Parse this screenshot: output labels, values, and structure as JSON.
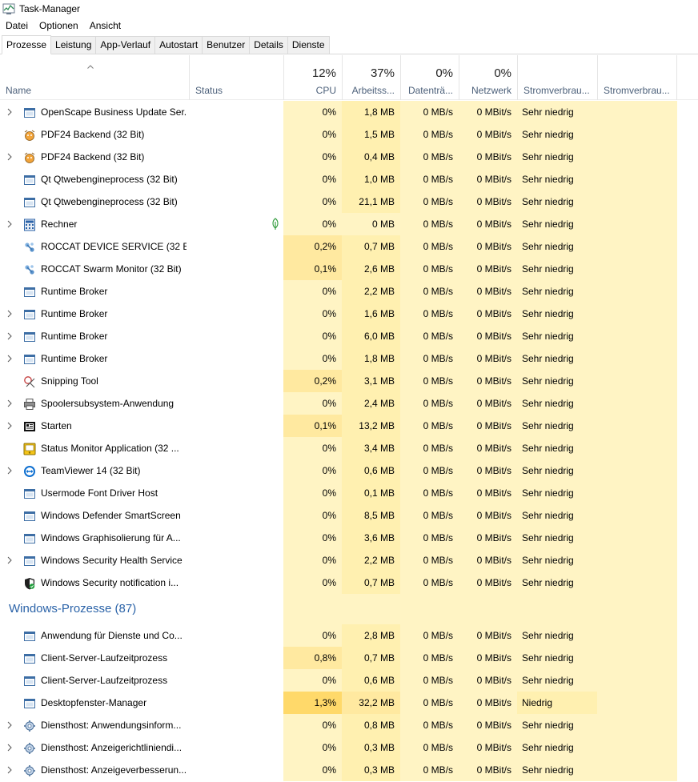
{
  "window": {
    "title": "Task-Manager"
  },
  "menu": [
    "Datei",
    "Optionen",
    "Ansicht"
  ],
  "tabs": [
    "Prozesse",
    "Leistung",
    "App-Verlauf",
    "Autostart",
    "Benutzer",
    "Details",
    "Dienste"
  ],
  "active_tab": "Prozesse",
  "header": {
    "name": "Name",
    "status": "Status",
    "cpu": {
      "pct": "12%",
      "label": "CPU"
    },
    "mem": {
      "pct": "37%",
      "label": "Arbeitss..."
    },
    "disk": {
      "pct": "0%",
      "label": "Datenträ..."
    },
    "net": {
      "pct": "0%",
      "label": "Netzwerk"
    },
    "power": {
      "label": "Stromverbrau..."
    },
    "power_trend": {
      "label": "Stromverbrau..."
    }
  },
  "colors": {
    "accent": "#2b63a8",
    "heat_low": "#fff4c4",
    "heat_mid": "#fff0b0",
    "heat_high": "#ffe9a0",
    "heat_max": "#ffd96a"
  },
  "apps": [
    {
      "name": "OpenScape Business Update Ser...",
      "icon": "window-app-icon",
      "expand": true,
      "cpu": "0%",
      "mem": "1,8 MB",
      "disk": "0 MB/s",
      "net": "0 MBit/s",
      "power": "Sehr niedrig"
    },
    {
      "name": "PDF24 Backend (32 Bit)",
      "icon": "pdf24-icon",
      "expand": false,
      "cpu": "0%",
      "mem": "1,5 MB",
      "disk": "0 MB/s",
      "net": "0 MBit/s",
      "power": "Sehr niedrig"
    },
    {
      "name": "PDF24 Backend (32 Bit)",
      "icon": "pdf24-icon",
      "expand": true,
      "cpu": "0%",
      "mem": "0,4 MB",
      "disk": "0 MB/s",
      "net": "0 MBit/s",
      "power": "Sehr niedrig"
    },
    {
      "name": "Qt Qtwebengineprocess (32 Bit)",
      "icon": "window-app-icon",
      "expand": false,
      "cpu": "0%",
      "mem": "1,0 MB",
      "disk": "0 MB/s",
      "net": "0 MBit/s",
      "power": "Sehr niedrig"
    },
    {
      "name": "Qt Qtwebengineprocess (32 Bit)",
      "icon": "window-app-icon",
      "expand": false,
      "cpu": "0%",
      "mem": "21,1 MB",
      "disk": "0 MB/s",
      "net": "0 MBit/s",
      "power": "Sehr niedrig"
    },
    {
      "name": "Rechner",
      "icon": "calculator-icon",
      "expand": true,
      "status_leaf": true,
      "cpu": "0%",
      "mem": "0 MB",
      "disk": "0 MB/s",
      "net": "0 MBit/s",
      "power": "Sehr niedrig"
    },
    {
      "name": "ROCCAT DEVICE SERVICE (32 Bit)",
      "icon": "roccat-icon",
      "expand": false,
      "cpu": "0,2%",
      "mem": "0,7 MB",
      "disk": "0 MB/s",
      "net": "0 MBit/s",
      "power": "Sehr niedrig"
    },
    {
      "name": "ROCCAT Swarm Monitor (32 Bit)",
      "icon": "roccat-icon",
      "expand": false,
      "cpu": "0,1%",
      "mem": "2,6 MB",
      "disk": "0 MB/s",
      "net": "0 MBit/s",
      "power": "Sehr niedrig"
    },
    {
      "name": "Runtime Broker",
      "icon": "window-app-icon",
      "expand": false,
      "cpu": "0%",
      "mem": "2,2 MB",
      "disk": "0 MB/s",
      "net": "0 MBit/s",
      "power": "Sehr niedrig"
    },
    {
      "name": "Runtime Broker",
      "icon": "window-app-icon",
      "expand": true,
      "cpu": "0%",
      "mem": "1,6 MB",
      "disk": "0 MB/s",
      "net": "0 MBit/s",
      "power": "Sehr niedrig"
    },
    {
      "name": "Runtime Broker",
      "icon": "window-app-icon",
      "expand": true,
      "cpu": "0%",
      "mem": "6,0 MB",
      "disk": "0 MB/s",
      "net": "0 MBit/s",
      "power": "Sehr niedrig"
    },
    {
      "name": "Runtime Broker",
      "icon": "window-app-icon",
      "expand": true,
      "cpu": "0%",
      "mem": "1,8 MB",
      "disk": "0 MB/s",
      "net": "0 MBit/s",
      "power": "Sehr niedrig"
    },
    {
      "name": "Snipping Tool",
      "icon": "snipping-tool-icon",
      "expand": false,
      "cpu": "0,2%",
      "mem": "3,1 MB",
      "disk": "0 MB/s",
      "net": "0 MBit/s",
      "power": "Sehr niedrig"
    },
    {
      "name": "Spoolersubsystem-Anwendung",
      "icon": "printer-icon",
      "expand": true,
      "cpu": "0%",
      "mem": "2,4 MB",
      "disk": "0 MB/s",
      "net": "0 MBit/s",
      "power": "Sehr niedrig"
    },
    {
      "name": "Starten",
      "icon": "start-icon",
      "expand": true,
      "cpu": "0,1%",
      "mem": "13,2 MB",
      "disk": "0 MB/s",
      "net": "0 MBit/s",
      "power": "Sehr niedrig"
    },
    {
      "name": "Status Monitor Application (32 ...",
      "icon": "status-monitor-icon",
      "expand": false,
      "cpu": "0%",
      "mem": "3,4 MB",
      "disk": "0 MB/s",
      "net": "0 MBit/s",
      "power": "Sehr niedrig"
    },
    {
      "name": "TeamViewer 14 (32 Bit)",
      "icon": "teamviewer-icon",
      "expand": true,
      "cpu": "0%",
      "mem": "0,6 MB",
      "disk": "0 MB/s",
      "net": "0 MBit/s",
      "power": "Sehr niedrig"
    },
    {
      "name": "Usermode Font Driver Host",
      "icon": "window-app-icon",
      "expand": false,
      "cpu": "0%",
      "mem": "0,1 MB",
      "disk": "0 MB/s",
      "net": "0 MBit/s",
      "power": "Sehr niedrig"
    },
    {
      "name": "Windows Defender SmartScreen",
      "icon": "window-app-icon",
      "expand": false,
      "cpu": "0%",
      "mem": "8,5 MB",
      "disk": "0 MB/s",
      "net": "0 MBit/s",
      "power": "Sehr niedrig"
    },
    {
      "name": "Windows Graphisolierung für A...",
      "icon": "window-app-icon",
      "expand": false,
      "cpu": "0%",
      "mem": "3,6 MB",
      "disk": "0 MB/s",
      "net": "0 MBit/s",
      "power": "Sehr niedrig"
    },
    {
      "name": "Windows Security Health Service",
      "icon": "window-app-icon",
      "expand": true,
      "cpu": "0%",
      "mem": "2,2 MB",
      "disk": "0 MB/s",
      "net": "0 MBit/s",
      "power": "Sehr niedrig"
    },
    {
      "name": "Windows Security notification i...",
      "icon": "security-shield-icon",
      "expand": false,
      "cpu": "0%",
      "mem": "0,7 MB",
      "disk": "0 MB/s",
      "net": "0 MBit/s",
      "power": "Sehr niedrig"
    }
  ],
  "windows_group": {
    "title": "Windows-Prozesse (87)"
  },
  "windows_processes": [
    {
      "name": "Anwendung für Dienste und Co...",
      "icon": "window-app-icon",
      "expand": false,
      "cpu": "0%",
      "mem": "2,8 MB",
      "disk": "0 MB/s",
      "net": "0 MBit/s",
      "power": "Sehr niedrig"
    },
    {
      "name": "Client-Server-Laufzeitprozess",
      "icon": "window-app-icon",
      "expand": false,
      "cpu": "0,8%",
      "mem": "0,7 MB",
      "disk": "0 MB/s",
      "net": "0 MBit/s",
      "power": "Sehr niedrig"
    },
    {
      "name": "Client-Server-Laufzeitprozess",
      "icon": "window-app-icon",
      "expand": false,
      "cpu": "0%",
      "mem": "0,6 MB",
      "disk": "0 MB/s",
      "net": "0 MBit/s",
      "power": "Sehr niedrig"
    },
    {
      "name": "Desktopfenster-Manager",
      "icon": "window-app-icon",
      "expand": false,
      "cpu": "1,3%",
      "mem": "32,2 MB",
      "disk": "0 MB/s",
      "net": "0 MBit/s",
      "power": "Niedrig"
    },
    {
      "name": "Diensthost: Anwendungsinform...",
      "icon": "gear-icon",
      "expand": true,
      "cpu": "0%",
      "mem": "0,8 MB",
      "disk": "0 MB/s",
      "net": "0 MBit/s",
      "power": "Sehr niedrig"
    },
    {
      "name": "Diensthost: Anzeigerichtliniendi...",
      "icon": "gear-icon",
      "expand": true,
      "cpu": "0%",
      "mem": "0,3 MB",
      "disk": "0 MB/s",
      "net": "0 MBit/s",
      "power": "Sehr niedrig"
    },
    {
      "name": "Diensthost: Anzeigeverbesserun...",
      "icon": "gear-icon",
      "expand": true,
      "cpu": "0%",
      "mem": "0,3 MB",
      "disk": "0 MB/s",
      "net": "0 MBit/s",
      "power": "Sehr niedrig"
    }
  ]
}
